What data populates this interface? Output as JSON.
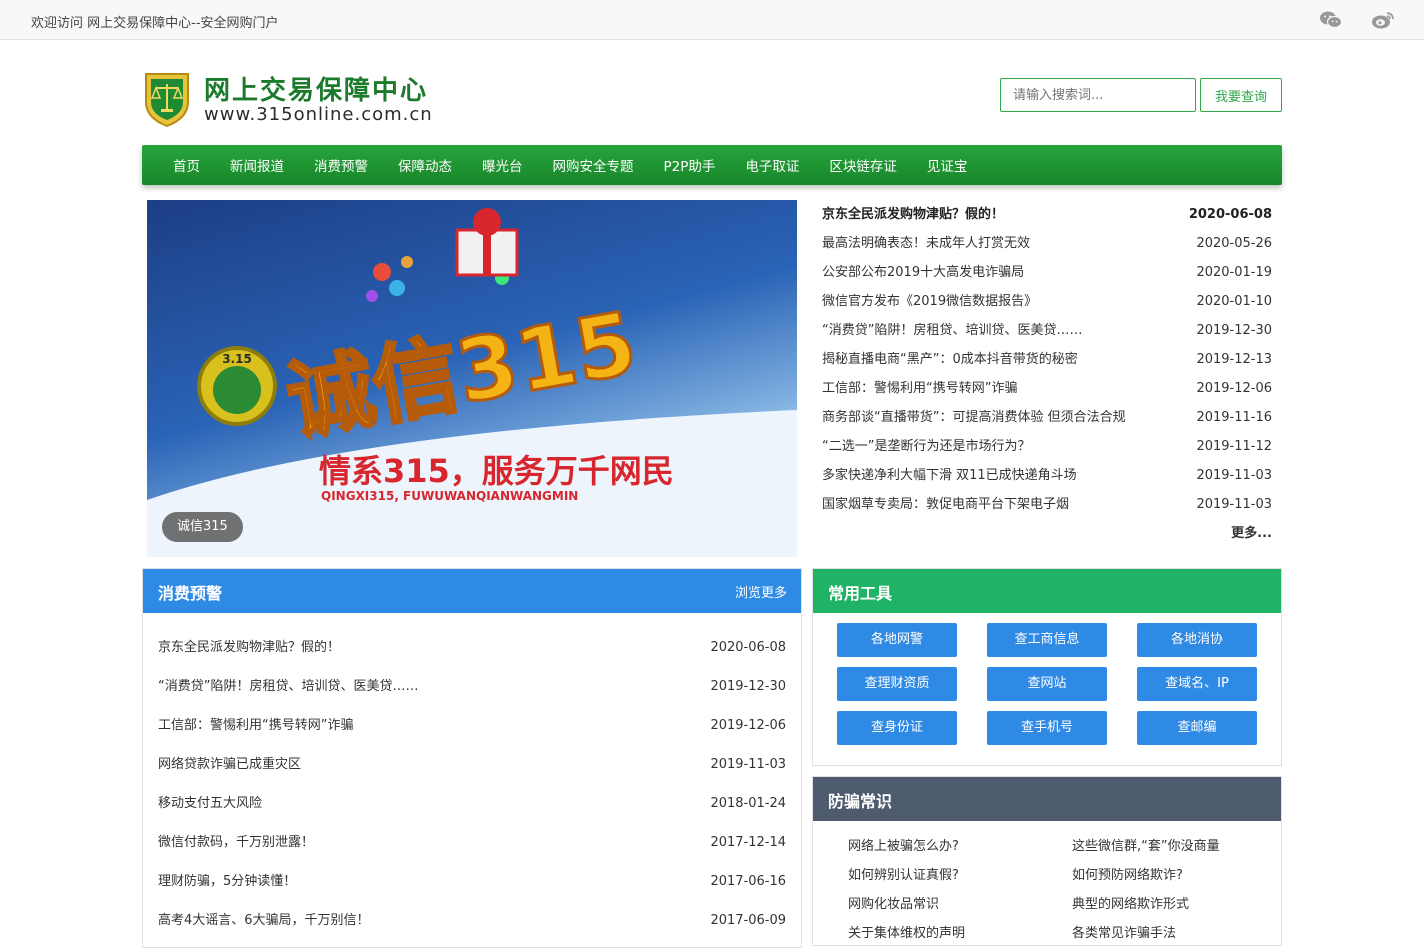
{
  "topbar": {
    "welcome": "欢迎访问 网上交易保障中心--安全网购门户",
    "icons": [
      "wechat-icon",
      "weibo-icon"
    ]
  },
  "header": {
    "site_name": "网上交易保障中心",
    "site_url": "www.315online.com.cn",
    "search_placeholder": "请输入搜索词...",
    "search_button": "我要查询"
  },
  "nav": {
    "items": [
      "首页",
      "新闻报道",
      "消费预警",
      "保障动态",
      "曝光台",
      "网购安全专题",
      "P2P助手",
      "电子取证",
      "区块链存证",
      "见证宝"
    ]
  },
  "banner": {
    "headline": "诚信315",
    "slogan": "情系315，服务万千网民",
    "slogan_pinyin": "QINGXI315, FUWUWANQIANWANGMIN",
    "badge_text": "3.15",
    "caption": "诚信315"
  },
  "news": {
    "items": [
      {
        "title": "京东全民派发购物津贴？假的！",
        "date": "2020-06-08"
      },
      {
        "title": "最高法明确表态！未成年人打赏无效",
        "date": "2020-05-26"
      },
      {
        "title": "公安部公布2019十大高发电诈骗局",
        "date": "2020-01-19"
      },
      {
        "title": "微信官方发布《2019微信数据报告》",
        "date": "2020-01-10"
      },
      {
        "title": "“消费贷”陷阱！房租贷、培训贷、医美贷……",
        "date": "2019-12-30"
      },
      {
        "title": "揭秘直播电商“黑产”：0成本抖音带货的秘密",
        "date": "2019-12-13"
      },
      {
        "title": "工信部：警惕利用“携号转网”诈骗",
        "date": "2019-12-06"
      },
      {
        "title": "商务部谈“直播带货”：可提高消费体验 但须合法合规",
        "date": "2019-11-16"
      },
      {
        "title": "“二选一”是垄断行为还是市场行为？",
        "date": "2019-11-12"
      },
      {
        "title": "多家快递净利大幅下滑 双11已成快递角斗场",
        "date": "2019-11-03"
      },
      {
        "title": "国家烟草专卖局：敦促电商平台下架电子烟",
        "date": "2019-11-03"
      }
    ],
    "more": "更多..."
  },
  "alert_panel": {
    "title": "消费预警",
    "more": "浏览更多",
    "items": [
      {
        "title": "京东全民派发购物津贴？假的！",
        "date": "2020-06-08"
      },
      {
        "title": "“消费贷”陷阱！房租贷、培训贷、医美贷……",
        "date": "2019-12-30"
      },
      {
        "title": "工信部：警惕利用“携号转网”诈骗",
        "date": "2019-12-06"
      },
      {
        "title": "网络贷款诈骗已成重灾区",
        "date": "2019-11-03"
      },
      {
        "title": "移动支付五大风险",
        "date": "2018-01-24"
      },
      {
        "title": "微信付款码，千万别泄露！",
        "date": "2017-12-14"
      },
      {
        "title": "理财防骗，5分钟读懂！",
        "date": "2017-06-16"
      },
      {
        "title": "高考4大谣言、6大骗局，千万别信！",
        "date": "2017-06-09"
      }
    ]
  },
  "tools_panel": {
    "title": "常用工具",
    "buttons": [
      "各地网警",
      "查工商信息",
      "各地消协",
      "查理财资质",
      "查网站",
      "查域名、IP",
      "查身份证",
      "查手机号",
      "查邮编"
    ]
  },
  "antifraud_panel": {
    "title": "防骗常识",
    "items": [
      "网络上被骗怎么办?",
      "这些微信群,“套”你没商量",
      "如何辨别认证真假?",
      "如何预防网络欺诈?",
      "网购化妆品常识",
      "典型的网络欺诈形式",
      "关于集体维权的声明",
      "各类常见诈骗手法"
    ]
  },
  "colors": {
    "brand_green": "#1c7a2c",
    "nav_green": "#17862a",
    "alert_blue": "#2f8ae5",
    "tools_green": "#1fb465",
    "antifraud_gray": "#4e5a6e"
  }
}
